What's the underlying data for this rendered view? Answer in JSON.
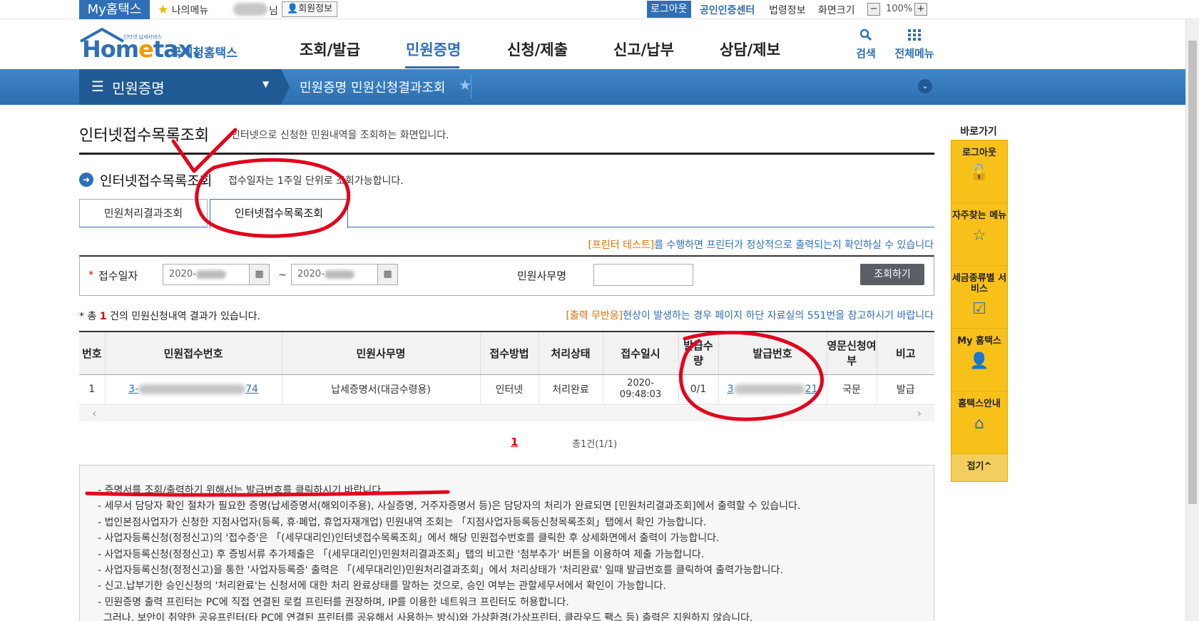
{
  "topbar": {
    "my_hometax": "My홈택스",
    "my_menu": "나의메뉴",
    "nim": "님",
    "member_info": "회원정보",
    "logout": "로그아웃",
    "cert_center": "공인인증센터",
    "law_info": "법령정보",
    "screen_size": "화면크기",
    "zoom_minus": "−",
    "zoom_value": "100%",
    "zoom_plus": "+"
  },
  "header": {
    "logo_tiny": "인터넷 납세서비스",
    "logo_brand_1": "Hom",
    "logo_brand_e": "e",
    "logo_brand_2": "tax.",
    "logo_sub": "국세청홈택스",
    "gnb": [
      "조회/발급",
      "민원증명",
      "신청/제출",
      "신고/납부",
      "상담/제보"
    ],
    "search_label": "검색",
    "allmenu_label": "전체메뉴"
  },
  "bluebar": {
    "category": "민원증명",
    "breadcrumb": "민원증명 민원신청결과조회"
  },
  "main": {
    "page_title": "인터넷접수목록조회",
    "page_desc": "인터넷으로 신청한 민원내역을 조회하는 화면입니다.",
    "section_title": "인터넷접수목록조회",
    "section_note": "접수일자는 1주일 단위로 조회가능합니다.",
    "tabs": [
      "민원처리결과조회",
      "인터넷접수목록조회"
    ],
    "printer_note_link": "[프린터 테스트]",
    "printer_note_text": "를 수행하면 프린터가 정상적으로 출력되는지 확인하실 수 있습니다",
    "search": {
      "date_label": "접수일자",
      "date_from": "2020-",
      "date_to": "2020-",
      "tilde": "~",
      "office_label": "민원사무명",
      "office_value": "",
      "search_button": "조회하기"
    },
    "result_prefix": "* 총 ",
    "result_count": "1",
    "result_suffix": " 건의 민원신청내역 결과가 있습니다.",
    "warn_link": "[출력 무반응]",
    "warn_text": "현상이 발생하는 경우 페이지 하단 자료실의 551번을 참고하시기 바랍니다",
    "table": {
      "headers": [
        "번호",
        "민원접수번호",
        "민원사무명",
        "접수방법",
        "처리상태",
        "접수일시",
        "발급수량",
        "발급번호",
        "영문신청여부",
        "비고"
      ],
      "rows": [
        {
          "no": "1",
          "receipt_no_start": "3-",
          "receipt_no_end": "74",
          "office": "납세증명서(대금수령용)",
          "method": "인터넷",
          "status": "처리완료",
          "date": "2020-",
          "time": "09:48:03",
          "qty": "0/1",
          "issue_no_start": "3",
          "issue_no_end": "21",
          "english": "국문",
          "note": "발급"
        }
      ]
    },
    "page_current": "1",
    "page_total": "총1건(1/1)",
    "notice": [
      "- 증명서를 조회/출력하기 위해서는 발급번호를 클릭하시기 바랍니다.",
      "- 세무서 담당자 확인 절차가 필요한 증명(납세증명서(해외이주용), 사실증명, 거주자증명서 등)은 담당자의 처리가 완료되면 [민원처리결과조회]에서 출력할 수 있습니다.",
      "- 법인본점사업자가 신청한 지점사업자(등록, 휴·폐업, 휴업자재개업) 민원내역 조회는 「지점사업자등록등신청목록조회」탭에서 확인 가능합니다.",
      "- 사업자등록신청(정정신고)의 '접수증'은 「(세무대리인)인터넷접수목록조회」에서 해당 민원접수번호를 클릭한 후 상세화면에서 출력이 가능합니다.",
      "- 사업자등록신청(정정신고) 후 증빙서류 추가제출은 「(세무대리인)민원처리결과조회」탭의 비고란 '첨부추가' 버튼을 이용하여 제출 가능합니다.",
      "- 사업자등록신청(정정신고)을 통한 '사업자등록증' 출력은 「(세무대리인)민원처리결과조회」에서 처리상태가 '처리완료' 일때 발급번호를 클릭하여 출력가능합니다.",
      "- 신고.납부기한 승인신청의 '처리완료'는 신청서에 대한 처리 완료상태를 말하는 것으로, 승인 여부는 관할세무서에서 확인이 가능합니다.",
      "- 민원증명 출력 프린터는 PC에 직접 연결된 로컬 프린터를 권장하며, IP를 이용한 네트워크 프린터도 허용합니다.",
      "그러나, 보안이 취약한 공유프린터(타 PC에 연결된 프린터를 공유해서 사용하는 방식)와 가상환경(가상프린터, 클라우드 팩스 등) 출력은 지원하지 않습니다."
    ]
  },
  "quick": {
    "title": "바로가기",
    "items": [
      "로그아웃",
      "자주찾는 메뉴",
      "세금종류별 서비스",
      "My 홈택스",
      "홈택스안내"
    ],
    "fold": "접기^"
  },
  "colors": {
    "brand_blue": "#2f6fb5",
    "accent_orange": "#f39800",
    "quick_yellow": "#f8c11a",
    "annotation_red": "#e3001b"
  }
}
